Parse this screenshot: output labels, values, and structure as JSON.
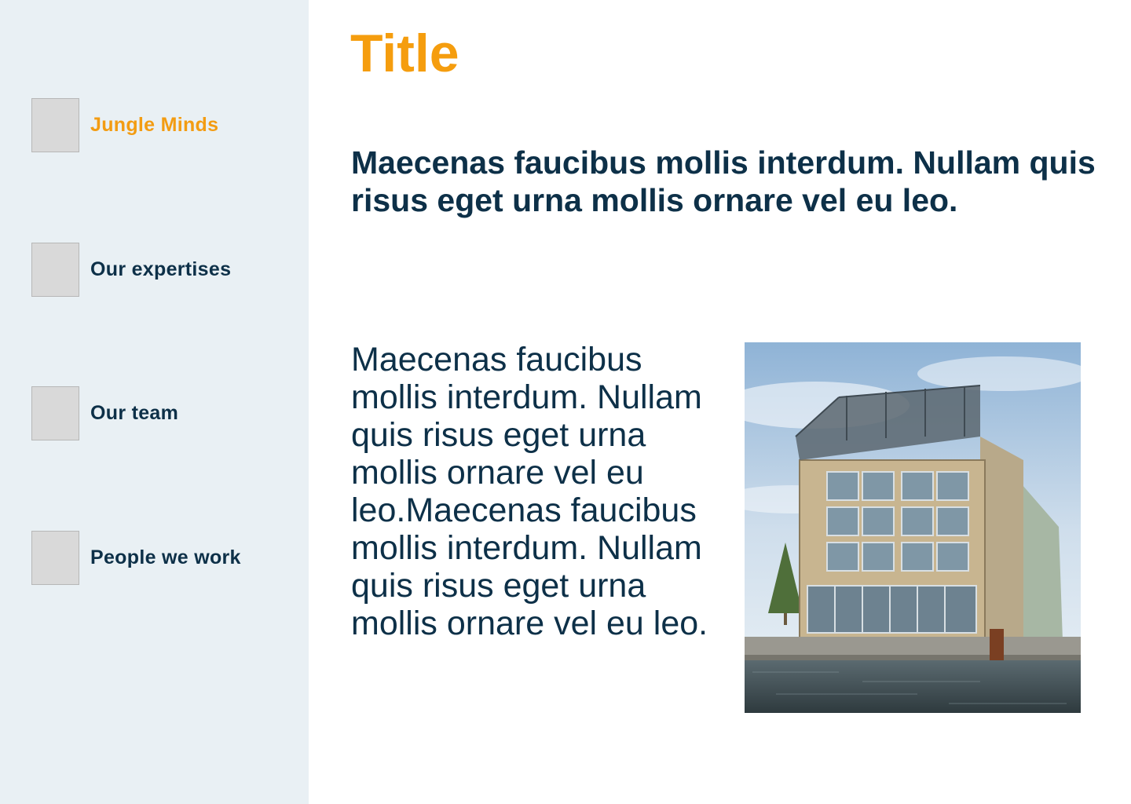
{
  "sidebar": {
    "items": [
      {
        "label": "Jungle Minds",
        "active": true
      },
      {
        "label": "Our expertises",
        "active": false
      },
      {
        "label": "Our team",
        "active": false
      },
      {
        "label": "People we work",
        "active": false
      }
    ]
  },
  "main": {
    "title": "Title",
    "intro": "Maecenas faucibus mollis interdum. Nullam quis risus eget urna mollis ornare vel eu leo.",
    "body": "Maecenas faucibus mollis interdum. Nullam quis risus eget urna mollis ornare vel eu leo.Maecenas faucibus mollis interdum. Nullam quis risus eget urna mollis ornare vel eu leo."
  },
  "colors": {
    "accent": "#f59d0e",
    "text": "#0d3048",
    "sidebar_bg": "#e9f0f4",
    "thumbnail": "#d9d9d9"
  }
}
